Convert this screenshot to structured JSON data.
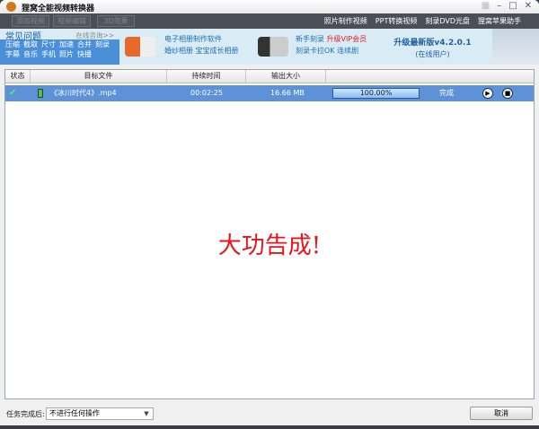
{
  "app": {
    "title": "狸窝全能视频转换器"
  },
  "toolbar": {
    "buttons": [
      "添加视频",
      "视频编辑",
      "3D效果"
    ],
    "links": [
      "照片制作视频",
      "PPT转换视频",
      "刻录DVD光盘",
      "狸窝苹果助手"
    ]
  },
  "banner": {
    "faq": {
      "title": "常见问题",
      "consult": "在线咨询>>",
      "row1": [
        "压缩",
        "截取",
        "尺寸",
        "加速",
        "合并",
        "刻录"
      ],
      "row2": [
        "字幕",
        "音乐",
        "手机",
        "照片",
        "快播"
      ]
    },
    "promo1": {
      "line1": "电子相册制作软件",
      "line2a": "婚纱相册",
      "line2b": "宝宝成长相册"
    },
    "promo2": {
      "line1a": "新手刻录",
      "line1b": "升级VIP会员",
      "line2a": "刻录卡拉OK",
      "line2b": "连续剧"
    },
    "upgrade": {
      "title": "升级最新版v4.2.0.1",
      "sub": "(在线用户)"
    }
  },
  "table": {
    "headers": [
      "状态",
      "目标文件",
      "持续时间",
      "输出大小"
    ],
    "rows": [
      {
        "file": "《冰川时代4》.mp4",
        "duration": "00:02:25",
        "size": "16.66 MB",
        "progress_percent": 100,
        "progress_text": "100.00%",
        "status": "完成"
      }
    ]
  },
  "main": {
    "message": "大功告成!"
  },
  "footer": {
    "label": "任务完成后:",
    "select_value": "不进行任何操作",
    "cancel": "取消"
  }
}
